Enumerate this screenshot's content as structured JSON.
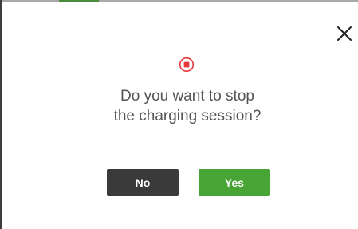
{
  "dialog": {
    "message_line1": "Do you want to stop",
    "message_line2": "the charging session?",
    "no_label": "No",
    "yes_label": "Yes"
  },
  "icons": {
    "close": "close-icon",
    "status": "stop-record-icon"
  },
  "colors": {
    "accent_red": "#e8383b",
    "yes_green": "#47a435",
    "no_dark": "#3a3a3a",
    "text_gray": "#555555"
  }
}
